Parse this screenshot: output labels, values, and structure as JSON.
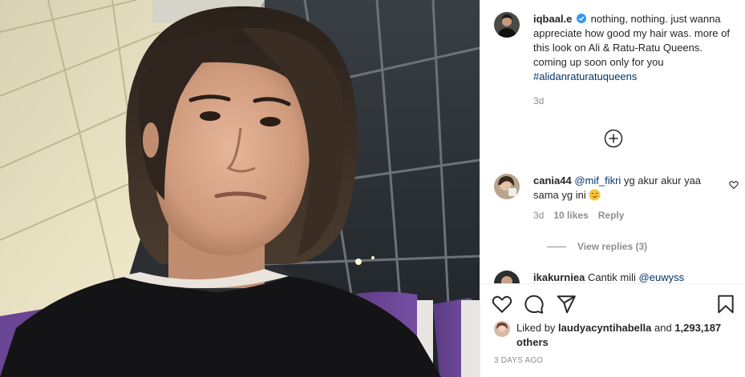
{
  "post": {
    "author": "iqbaal.e",
    "caption": "nothing, nothing. just wanna appreciate how good my hair was. more of this look on Ali & Ratu-Ratu Queens. coming up soon only for you",
    "hashtag": "#alidanraturatuqueens",
    "caption_time": "3d",
    "photo_alt": "Selfie of a young man with shoulder-length hair in a dark sweater, seated by airport windows"
  },
  "comments": [
    {
      "username": "cania44",
      "mention": "@mif_fikri",
      "text": "yg akur akur yaa sama yg ini",
      "emoji": "smirk-emoji",
      "time": "3d",
      "likes": "10 likes",
      "reply_label": "Reply",
      "view_replies": "View replies (3)"
    },
    {
      "username": "ikakurniea",
      "text": "Cantik mili",
      "mention": "@euwyss"
    }
  ],
  "actions": {
    "like_icon": "heart-icon",
    "comment_icon": "comment-bubble-icon",
    "share_icon": "paper-plane-icon",
    "save_icon": "bookmark-icon",
    "load_more_icon": "plus-circle-icon"
  },
  "likes": {
    "prefix": "Liked by",
    "user": "laudyacyntihabella",
    "conjunction": "and",
    "others": "1,293,187 others"
  },
  "timestamp": "3 DAYS AGO",
  "colors": {
    "text": "#262626",
    "muted": "#8e8e8e",
    "link": "#00376b",
    "verified": "#3897f0",
    "border": "#efefef"
  }
}
